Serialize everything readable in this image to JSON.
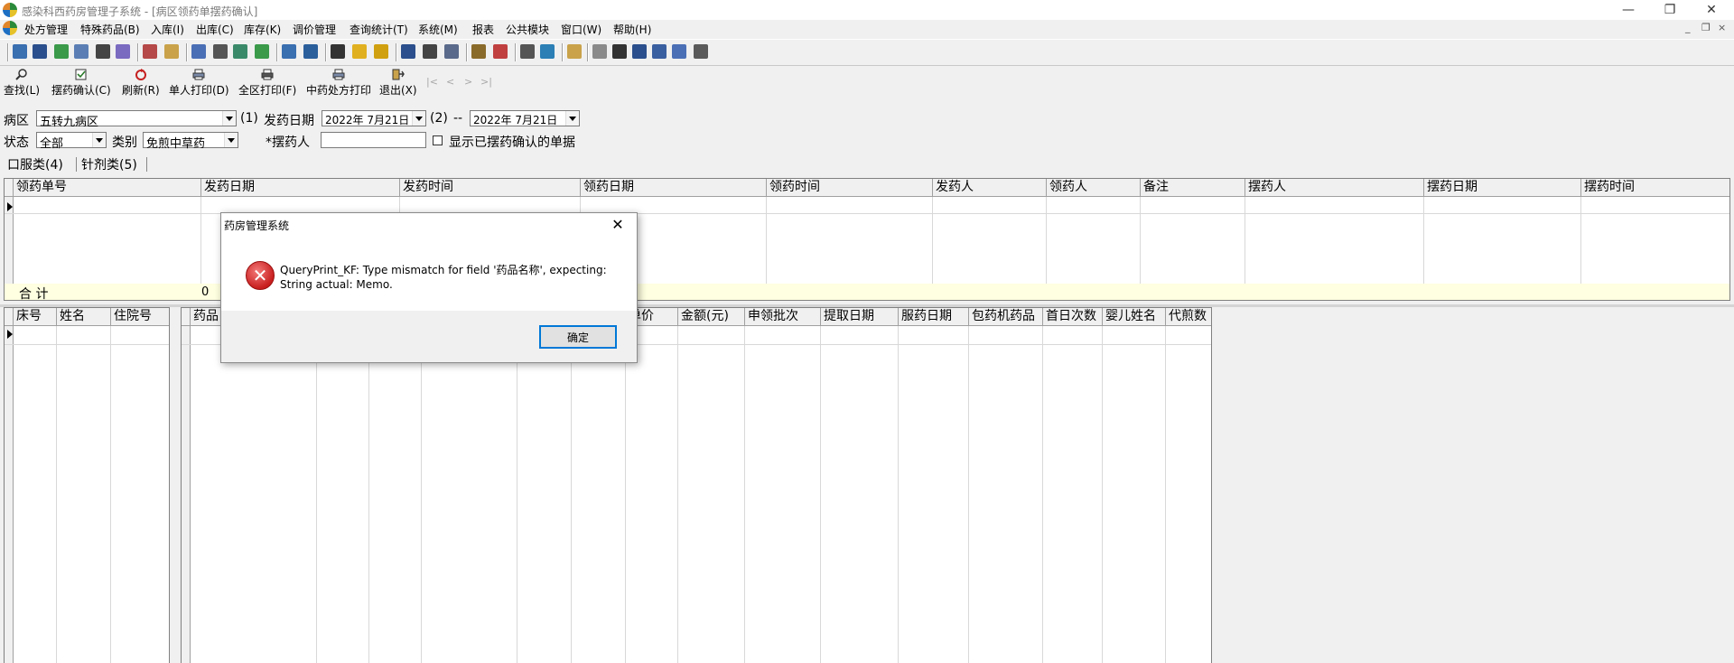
{
  "window": {
    "title": "感染科西药房管理子系统 - [病区领药单摆药确认]",
    "controls": [
      "—",
      "❐",
      "✕"
    ],
    "mdi_controls": [
      "_",
      "❐",
      "×"
    ]
  },
  "menu": [
    "处方管理",
    "特殊药品(B)",
    "入库(I)",
    "出库(C)",
    "库存(K)",
    "调价管理",
    "查询统计(T)",
    "系统(M)",
    "报表",
    "公共模块",
    "窗口(W)",
    "帮助(H)"
  ],
  "actions": [
    {
      "label": "查找(L)",
      "icon": "magnifier-icon"
    },
    {
      "label": "摆药确认(C)",
      "icon": "confirm-icon"
    },
    {
      "label": "刷新(R)",
      "icon": "refresh-icon"
    },
    {
      "label": "单人打印(D)",
      "icon": "printer-icon"
    },
    {
      "label": "全区打印(F)",
      "icon": "printer-icon"
    },
    {
      "label": "中药处方打印",
      "icon": "printer-icon"
    },
    {
      "label": "退出(X)",
      "icon": "exit-icon"
    }
  ],
  "nav_arrows": [
    "|<",
    "<",
    ">",
    ">|"
  ],
  "filters": {
    "ward_label": "病区",
    "ward_value": "五转九病区",
    "step1": "(1)",
    "dispense_date_label": "发药日期",
    "date_from": "2022年 7月21日",
    "step2": "(2)",
    "dash": "--",
    "date_to": "2022年 7月21日",
    "status_label": "状态",
    "status_value": "全部",
    "category_label": "类别",
    "category_value": "免煎中草药",
    "dispenser_label": "*摆药人",
    "dispenser_value": "",
    "show_confirmed_label": "显示已摆药确认的单据"
  },
  "tabs": [
    "口服类(4)",
    "针剂类(5)"
  ],
  "top_grid": {
    "columns": [
      "领药单号",
      "发药日期",
      "发药时间",
      "领药日期",
      "领药时间",
      "发药人",
      "领药人",
      "备注",
      "摆药人",
      "摆药日期",
      "摆药时间"
    ],
    "sum_label": "合  计",
    "sum_value": "0"
  },
  "left_grid": {
    "columns": [
      "床号",
      "姓名",
      "住院号"
    ]
  },
  "right_grid": {
    "columns": [
      "药品",
      "",
      "",
      "",
      "",
      "",
      "单价",
      "金额(元)",
      "申领批次",
      "提取日期",
      "服药日期",
      "包药机药品",
      "首日次数",
      "婴儿姓名",
      "代煎数"
    ]
  },
  "dialog": {
    "title": "药房管理系统",
    "close": "✕",
    "message": "QueryPrint_KF: Type mismatch for field '药品名称', expecting: String actual: Memo.",
    "ok": "确定"
  }
}
